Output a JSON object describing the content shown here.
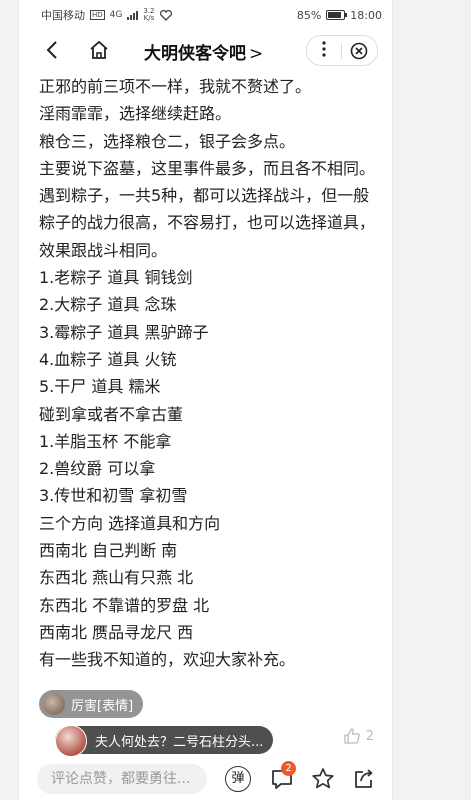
{
  "status_bar": {
    "carrier": "中国移动",
    "network_badge": "HD",
    "signal": "4G",
    "speed_value": "3.2",
    "speed_unit": "K/s",
    "battery_percent": "85%",
    "battery_level": 0.85,
    "time": "18:00"
  },
  "nav": {
    "back_icon": "back-arrow-icon",
    "home_icon": "home-icon",
    "title": "大明侠客令吧",
    "title_chevron": ">",
    "more_icon": "more-dots-icon",
    "close_icon": "close-circle-icon"
  },
  "post": {
    "lines": [
      "正邪的前三项不一样，我就不赘述了。",
      "淫雨霏霏，选择继续赶路。",
      "粮仓三，选择粮仓二，银子会多点。",
      "主要说下盗墓，这里事件最多，而且各不相同。",
      "遇到粽子，一共5种，都可以选择战斗，但一般粽子的战力很高，不容易打，也可以选择道具，效果跟战斗相同。",
      "1.老粽子 道具 铜钱剑",
      "2.大粽子 道具 念珠",
      "3.霉粽子 道具 黑驴蹄子",
      "4.血粽子 道具 火铳",
      "5.干尸 道具 糯米",
      "碰到拿或者不拿古董",
      "1.羊脂玉杯 不能拿",
      "2.兽纹爵 可以拿",
      "3.传世和初雪 拿初雪",
      "三个方向 选择道具和方向",
      "西南北 自己判断 南",
      "东西北 燕山有只燕 北",
      "东西北 不靠谱的罗盘 北",
      "西南北 赝品寻龙尺 西",
      "有一些我不知道的，欢迎大家补充。"
    ]
  },
  "danmaku": [
    {
      "text": "厉害[表情]"
    },
    {
      "text": "夫人何处去？二号石柱分头..."
    }
  ],
  "likes": {
    "icon": "thumb-up-icon",
    "count": "2"
  },
  "bottom_bar": {
    "comment_placeholder": "评论点赞，都要勇往...",
    "danmaku_toggle": "弹",
    "comment_icon": "comment-bubble-icon",
    "comment_badge": "2",
    "favorite_icon": "star-icon",
    "share_icon": "share-icon"
  },
  "colors": {
    "badge": "#f05a2a",
    "danmaku_bg": "#282828"
  }
}
